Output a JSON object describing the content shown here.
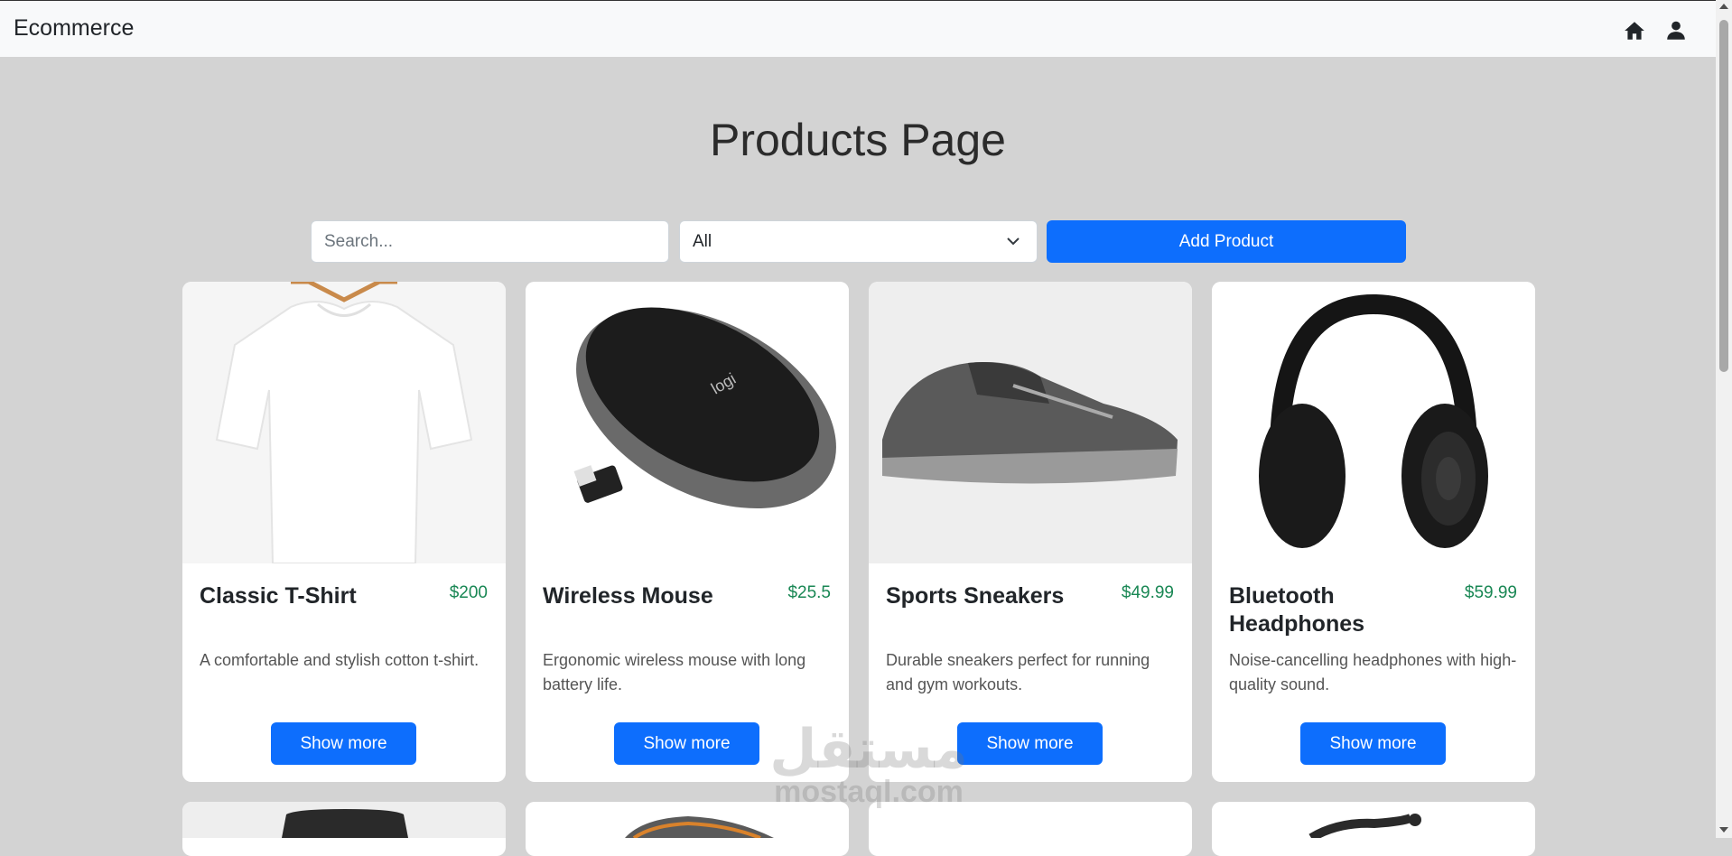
{
  "navbar": {
    "brand": "Ecommerce",
    "icons": [
      "home-icon",
      "user-icon"
    ]
  },
  "page": {
    "title": "Products Page"
  },
  "filters": {
    "search_placeholder": "Search...",
    "category_selected": "All",
    "add_button_label": "Add Product"
  },
  "accent_colors": {
    "primary": "#0d6efd",
    "price": "#198754",
    "page_bg": "#d3d3d3"
  },
  "products": [
    {
      "name": "Classic T-Shirt",
      "price": "$200",
      "description": "A comfortable and stylish cotton t-shirt.",
      "button": "Show more"
    },
    {
      "name": "Wireless Mouse",
      "price": "$25.5",
      "description": "Ergonomic wireless mouse with long battery life.",
      "button": "Show more"
    },
    {
      "name": "Sports Sneakers",
      "price": "$49.99",
      "description": "Durable sneakers perfect for running and gym workouts.",
      "button": "Show more"
    },
    {
      "name": "Bluetooth Headphones",
      "price": "$59.99",
      "description": "Noise-cancelling headphones with high-quality sound.",
      "button": "Show more"
    }
  ],
  "watermark": {
    "arabic": "مستقل",
    "latin": "mostaql.com"
  }
}
